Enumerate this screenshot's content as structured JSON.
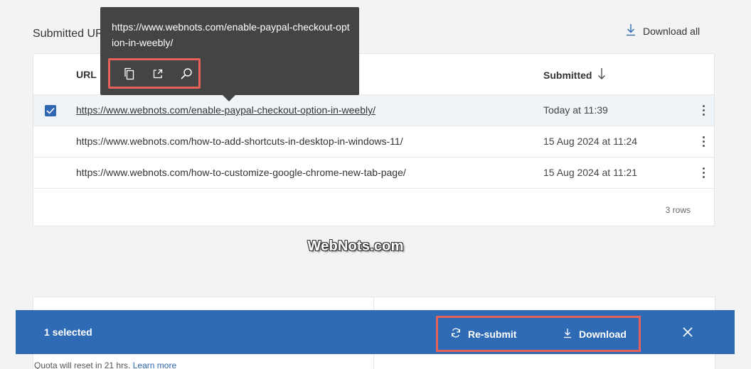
{
  "section": {
    "title": "Submitted URLs"
  },
  "toolbar": {
    "download_all_label": "Download all",
    "download_icon": "download-icon"
  },
  "table": {
    "headers": {
      "url": "URL",
      "submitted": "Submitted"
    },
    "sort_icon": "arrow-down-icon",
    "rows": [
      {
        "url": "https://www.webnots.com/enable-paypal-checkout-option-in-weebly/",
        "submitted": "Today at 11:39",
        "selected": true
      },
      {
        "url": "https://www.webnots.com/how-to-add-shortcuts-in-desktop-in-windows-11/",
        "submitted": "15 Aug 2024 at 11:24",
        "selected": false
      },
      {
        "url": "https://www.webnots.com/how-to-customize-google-chrome-new-tab-page/",
        "submitted": "15 Aug 2024 at 11:21",
        "selected": false
      }
    ],
    "row_count": "3 rows"
  },
  "tooltip": {
    "text": "https://www.webnots.com/enable-paypal-checkout-option-in-weebly/",
    "tools": [
      "copy-icon",
      "open-in-new-icon",
      "search-icon"
    ]
  },
  "watermark": "WebNots.com",
  "quota": {
    "text": "Quota will reset in 21 hrs.",
    "link": "Learn more"
  },
  "action_bar": {
    "selected_label": "1 selected",
    "resubmit_label": "Re-submit",
    "download_label": "Download",
    "close_icon": "close-icon"
  },
  "colors": {
    "accent": "#2f6ab5",
    "highlight_box": "#e8605a",
    "tooltip_bg": "#444444",
    "selected_row": "#eff4f9"
  }
}
